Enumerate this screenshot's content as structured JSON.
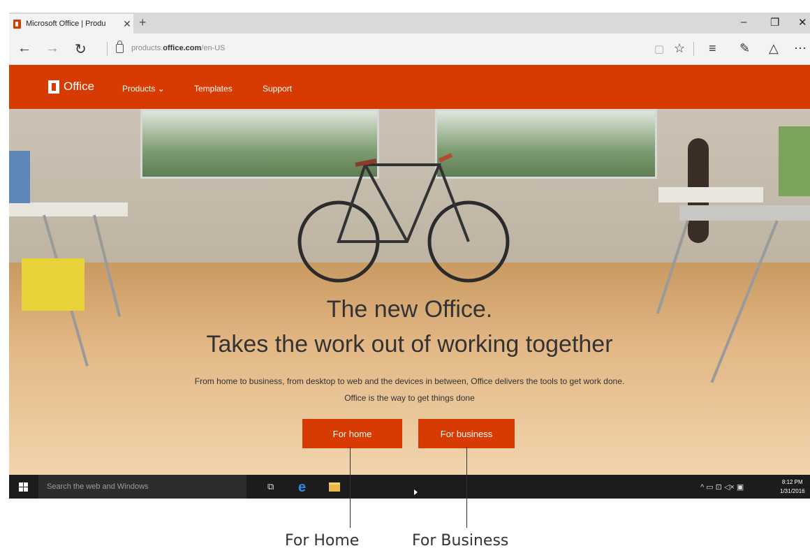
{
  "browser": {
    "tab_title": "Microsoft Office | Produ",
    "tab_close": "✕",
    "new_tab": "+",
    "window_controls": {
      "minimize": "–",
      "restore": "❐",
      "close": "✕"
    },
    "nav": {
      "back": "←",
      "forward": "→",
      "refresh": "↻"
    },
    "url_prefix": "products.",
    "url_domain": "office.com",
    "url_path": "/en-US",
    "tools": {
      "reading_view": "▢",
      "favorite": "☆",
      "hub": "≡",
      "web_note": "✎",
      "share": "△",
      "more": "⋯"
    },
    "favicon_color": "#d83b01"
  },
  "office": {
    "logo_text": "Office",
    "nav_items": [
      "Products ⌄",
      "Templates",
      "Support"
    ],
    "headline_1": "The new Office.",
    "headline_2": "Takes the work out of working together",
    "subline_1": "From home to business, from desktop to web and the devices in between, Office delivers the tools to get work done.",
    "subline_2": "Office is the way to get things done",
    "cta_home": "For home",
    "cta_business": "For business",
    "brand_color": "#d83b01"
  },
  "taskbar": {
    "search_placeholder": "Search the web and Windows",
    "task_view_icon": "⧉",
    "edge_icon": "e",
    "tray_icons": "^  ▭  ⊡  ◁×  ▣",
    "time": "8:12 PM",
    "date": "1/31/2016"
  },
  "callouts": {
    "home": "For Home",
    "business": "For Business"
  }
}
